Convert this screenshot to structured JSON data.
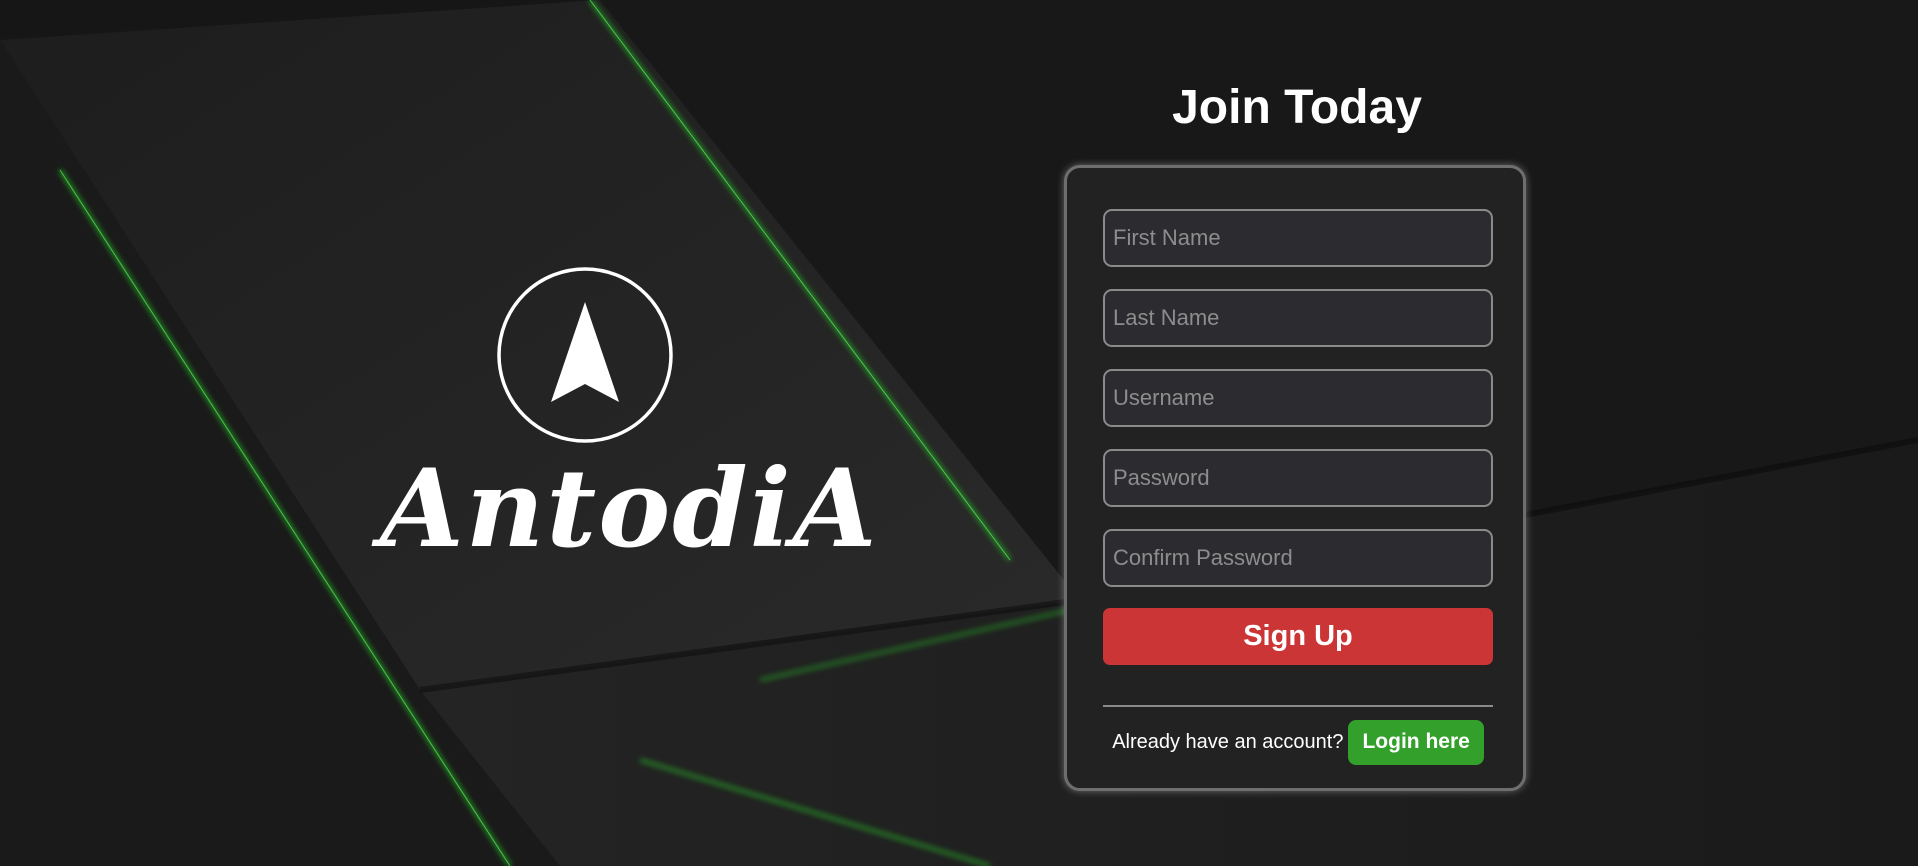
{
  "brand": {
    "name": "AntodiA",
    "logo_icon": "arrowhead-circle-logo"
  },
  "form": {
    "title": "Join Today",
    "fields": {
      "first_name": {
        "placeholder": "First Name",
        "value": ""
      },
      "last_name": {
        "placeholder": "Last Name",
        "value": ""
      },
      "username": {
        "placeholder": "Username",
        "value": ""
      },
      "password": {
        "placeholder": "Password",
        "value": ""
      },
      "confirm_password": {
        "placeholder": "Confirm Password",
        "value": ""
      }
    },
    "signup_label": "Sign Up",
    "login_prompt": "Already have an account?",
    "login_label": "Login here"
  },
  "colors": {
    "background": "#161616",
    "accent_green": "#2ecc2e",
    "signup_red": "#cc3535",
    "login_green": "#33a02c",
    "card": "#222222"
  }
}
